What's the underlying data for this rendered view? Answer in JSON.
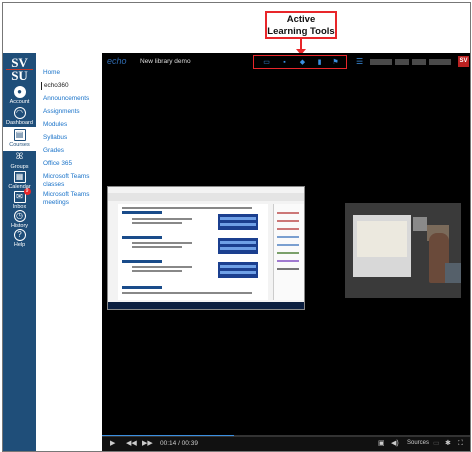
{
  "callout": {
    "text": "Active Learning Tools",
    "color": "#e8262a"
  },
  "logo": {
    "line1": "SV",
    "line2": "SU"
  },
  "global_nav": [
    {
      "label": "Account",
      "icon": "account-icon"
    },
    {
      "label": "Dashboard",
      "icon": "dashboard-icon"
    },
    {
      "label": "Courses",
      "icon": "courses-icon",
      "active": true
    },
    {
      "label": "Groups",
      "icon": "groups-icon"
    },
    {
      "label": "Calendar",
      "icon": "calendar-icon"
    },
    {
      "label": "Inbox",
      "icon": "inbox-icon",
      "badge": "9"
    },
    {
      "label": "History",
      "icon": "history-icon"
    },
    {
      "label": "Help",
      "icon": "help-icon"
    }
  ],
  "course_nav": [
    {
      "label": "Home"
    },
    {
      "label": "echo360",
      "current": true
    },
    {
      "label": "Announcements"
    },
    {
      "label": "Assignments"
    },
    {
      "label": "Modules"
    },
    {
      "label": "Syllabus"
    },
    {
      "label": "Grades"
    },
    {
      "label": "Office 365"
    },
    {
      "label": "Microsoft Teams classes"
    },
    {
      "label": "Microsoft Teams meetings"
    }
  ],
  "player": {
    "brand": "echo",
    "title": "New library demo",
    "brand_color": "#2f6bb0",
    "accent": "#3b8fe0",
    "tools": [
      "slides-icon",
      "chat-icon",
      "bookmark-icon",
      "flag-icon",
      "confusion-icon"
    ],
    "current_time": "00:14",
    "duration": "00:39",
    "progress": 0.36,
    "sources_label": "Sources",
    "time_display": "00:14 / 00:39"
  }
}
